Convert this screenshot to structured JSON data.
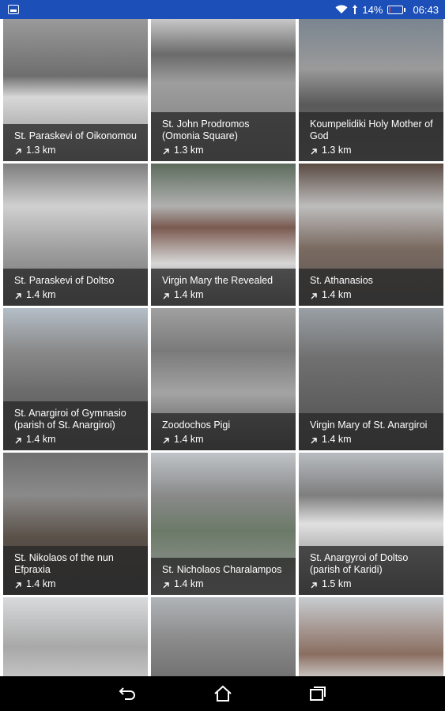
{
  "status_bar": {
    "battery_percent": "14%",
    "time": "06:43",
    "battery_level": 0.14
  },
  "places": [
    {
      "name": "St. Paraskevi of Oikonomou",
      "distance": "1.3 km"
    },
    {
      "name": "St. John Prodromos (Omonia Square)",
      "distance": "1.3 km"
    },
    {
      "name": "Koumpelidiki Holy Mother of God",
      "distance": "1.3 km"
    },
    {
      "name": "St. Paraskevi of Doltso",
      "distance": "1.4 km"
    },
    {
      "name": "Virgin Mary the Revealed",
      "distance": "1.4 km"
    },
    {
      "name": "St. Athanasios",
      "distance": "1.4 km"
    },
    {
      "name": "St. Anargiroi of Gymnasio (parish of St. Anargiroi)",
      "distance": "1.4 km"
    },
    {
      "name": "Zoodochos Pigi",
      "distance": "1.4 km"
    },
    {
      "name": "Virgin Mary of St. Anargiroi",
      "distance": "1.4 km"
    },
    {
      "name": "St. Nikolaos of the nun Efpraxia",
      "distance": "1.4 km"
    },
    {
      "name": "St. Nicholaos Charalampos",
      "distance": "1.4 km"
    },
    {
      "name": "St. Anargyroi of Doltso (parish of Karidi)",
      "distance": "1.5 km"
    }
  ],
  "colors": {
    "status_bar": "#1c4fb8",
    "overlay": "#282828",
    "nav_bar": "#000000"
  },
  "icons": {
    "distance": "arrow-up-right-icon",
    "nav_back": "back-icon",
    "nav_home": "home-icon",
    "nav_recents": "recents-icon"
  }
}
